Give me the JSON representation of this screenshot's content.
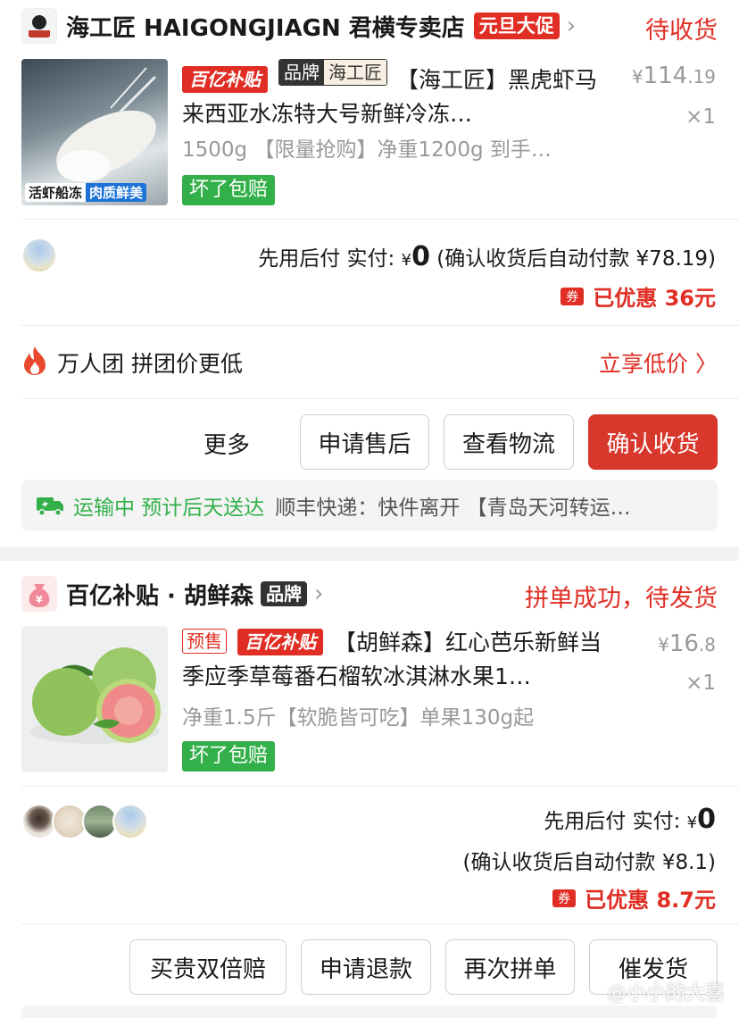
{
  "order1": {
    "shop_name": "海工匠 HAIGONGJIAGN 君横专卖店",
    "promo_badge": "元旦大促",
    "status": "待收货",
    "tag_subsidy": "百亿补贴",
    "tag_brand_left": "品牌",
    "tag_brand_right": "海工匠",
    "title": "【海工匠】黑虎虾马来西亚水冻特大号新鲜冷冻…",
    "spec": "1500g 【限量抢购】净重1200g 到手…",
    "guarantee": "坏了包赔",
    "price_int": "114",
    "price_dec": ".19",
    "price_symbol": "¥",
    "qty": "×1",
    "thumb_caption_left": "活虾船冻",
    "thumb_caption_right": "肉质鲜美",
    "pay_prefix": "先用后付 实付: ",
    "pay_symbol": "¥",
    "pay_amount": "0",
    "pay_suffix": " (确认收货后自动付款 ¥78.19)",
    "coupon_icon": "券",
    "saved": "已优惠 36元",
    "group_label": "万人团 拼团价更低",
    "group_link": "立享低价 〉",
    "btn_more": "更多",
    "btn_aftersale": "申请售后",
    "btn_logistics": "查看物流",
    "btn_confirm": "确认收货",
    "logistics_status": "运输中 预计后天送达",
    "logistics_detail": "顺丰快递：快件离开 【青岛天河转运…"
  },
  "order2": {
    "shop_name": "百亿补贴 · 胡鲜森",
    "brand_badge": "品牌",
    "status": "拼单成功，待发货",
    "tag_presale": "预售",
    "tag_subsidy": "百亿补贴",
    "title": "【胡鲜森】红心芭乐新鲜当季应季草莓番石榴软冰淇淋水果1…",
    "spec": "净重1.5斤【软脆皆可吃】单果130g起",
    "guarantee": "坏了包赔",
    "price_symbol": "¥",
    "price_int": "16",
    "price_dec": ".8",
    "qty": "×1",
    "pay_prefix": "先用后付 实付: ",
    "pay_symbol": "¥",
    "pay_amount": "0",
    "pay_auto": "(确认收货后自动付款 ¥8.1)",
    "coupon_icon": "券",
    "saved": "已优惠 8.7元",
    "btn_double": "买贵双倍赔",
    "btn_refund": "申请退款",
    "btn_regroup": "再次拼单",
    "btn_urge": "催发货"
  },
  "watermark": "@小小的大喜",
  "colors": {
    "accent_red": "#e02e24",
    "guarantee_green": "#33b04a",
    "page_gap": "#f2f2f2"
  }
}
